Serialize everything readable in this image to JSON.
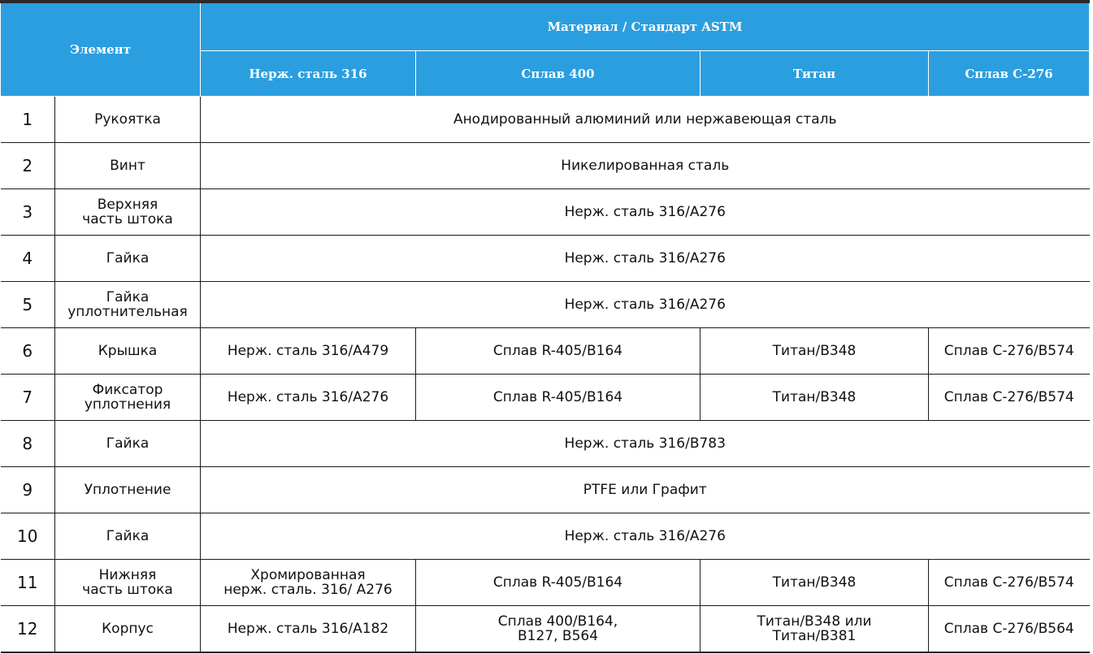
{
  "header": {
    "element_label": "Элемент",
    "material_label": "Материал / Стандарт ASTM",
    "columns": [
      "Нерж. сталь 316",
      "Сплав 400",
      "Титан",
      "Сплав С-276"
    ]
  },
  "rows": [
    {
      "num": "1",
      "element": "Рукоятка",
      "common": "Анодированный алюминий или нержавеющая сталь"
    },
    {
      "num": "2",
      "element": "Винт",
      "common": "Никелированная сталь"
    },
    {
      "num": "3",
      "element": [
        "Верхняя",
        "часть штока"
      ],
      "common": "Нерж. сталь 316/A276"
    },
    {
      "num": "4",
      "element": "Гайка",
      "common": "Нерж. сталь 316/A276"
    },
    {
      "num": "5",
      "element": [
        "Гайка",
        "уплотнительная"
      ],
      "common": "Нерж. сталь 316/A276"
    },
    {
      "num": "6",
      "element": "Крышка",
      "cells": [
        [
          "Нерж. сталь 316/A479"
        ],
        [
          "Сплав R-405/B164"
        ],
        [
          "Титан/B348"
        ],
        [
          "Сплав  С-276/B574"
        ]
      ]
    },
    {
      "num": "7",
      "element": [
        "Фиксатор",
        "уплотнения"
      ],
      "cells": [
        [
          "Нерж. сталь 316/A276"
        ],
        [
          "Сплав R-405/B164"
        ],
        [
          "Титан/B348"
        ],
        [
          "Сплав С-276/B574"
        ]
      ]
    },
    {
      "num": "8",
      "element": "Гайка",
      "common": "Нерж. сталь 316/B783"
    },
    {
      "num": "9",
      "element": "Уплотнение",
      "common": "PTFE или Графит"
    },
    {
      "num": "10",
      "element": "Гайка",
      "common": "Нерж. сталь 316/A276"
    },
    {
      "num": "11",
      "element": [
        "Нижняя",
        "часть штока"
      ],
      "cells": [
        [
          "Хромированная",
          "нерж. сталь. 316/ A276"
        ],
        [
          "Сплав R-405/B164"
        ],
        [
          "Титан/B348"
        ],
        [
          "Сплав  С-276/B574"
        ]
      ]
    },
    {
      "num": "12",
      "element": "Корпус",
      "cells": [
        [
          "Нерж. сталь 316/A182"
        ],
        [
          "Сплав 400/B164,",
          "B127, B564"
        ],
        [
          "Титан/B348 или",
          "Титан/B381"
        ],
        [
          "Сплав С-276/B564"
        ]
      ]
    }
  ]
}
